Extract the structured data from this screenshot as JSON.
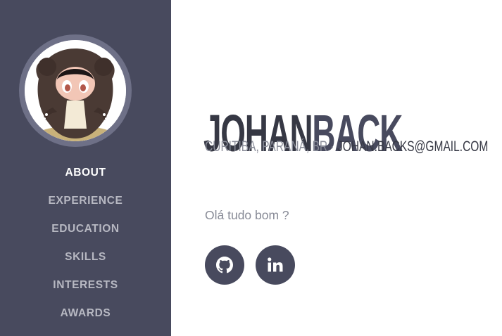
{
  "profile": {
    "first_name": "JOHAN",
    "last_name": "BACK",
    "location": "CURITIBA, PARANÁ, BR",
    "separator": "·",
    "email": "JOHAN.BACKS@GMAIL.COM",
    "intro": "Olá tudo bom ?"
  },
  "sidebar": {
    "items": [
      {
        "label": "ABOUT",
        "active": true
      },
      {
        "label": "EXPERIENCE"
      },
      {
        "label": "EDUCATION"
      },
      {
        "label": "SKILLS"
      },
      {
        "label": "INTERESTS"
      },
      {
        "label": "AWARDS"
      }
    ]
  },
  "social": [
    {
      "icon": "github-icon"
    },
    {
      "icon": "linkedin-icon"
    }
  ],
  "colors": {
    "sidebar_bg": "#484a5e",
    "avatar_ring": "#6e7087",
    "heading_dark": "#363844",
    "text_muted": "#878a96"
  }
}
